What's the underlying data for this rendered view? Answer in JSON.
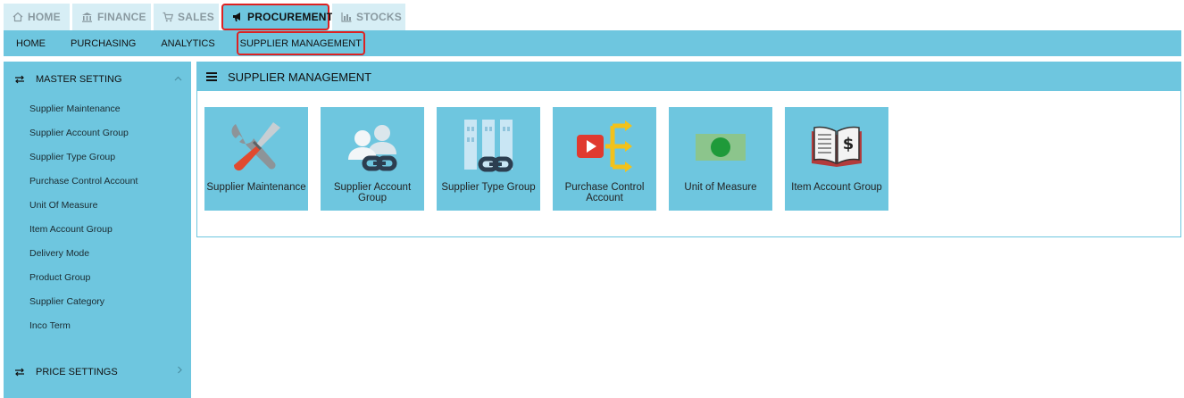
{
  "top_tabs": [
    {
      "label": "HOME",
      "icon": "home-icon"
    },
    {
      "label": "FINANCE",
      "icon": "bank-icon"
    },
    {
      "label": "SALES",
      "icon": "cart-icon"
    },
    {
      "label": "PROCUREMENT",
      "icon": "megaphone-icon",
      "active": true
    },
    {
      "label": "STOCKS",
      "icon": "bar-chart-icon"
    }
  ],
  "subnav": [
    "HOME",
    "PURCHASING",
    "ANALYTICS",
    "SUPPLIER MANAGEMENT"
  ],
  "sidebar": {
    "master_setting": "MASTER SETTING",
    "items": [
      "Supplier Maintenance",
      "Supplier Account Group",
      "Supplier Type Group",
      "Purchase Control Account",
      "Unit Of Measure",
      "Item Account Group",
      "Delivery Mode",
      "Product Group",
      "Supplier Category",
      "Inco Term"
    ],
    "price_settings": "PRICE SETTINGS"
  },
  "panel": {
    "title": "SUPPLIER MANAGEMENT",
    "tiles": [
      {
        "label": "Supplier Maintenance",
        "icon": "tools-icon"
      },
      {
        "label": "Supplier Account Group",
        "icon": "users-link-icon"
      },
      {
        "label": "Supplier Type Group",
        "icon": "buildings-link-icon"
      },
      {
        "label": "Purchase Control Account",
        "icon": "play-split-arrows-icon"
      },
      {
        "label": "Unit of Measure",
        "icon": "money-bill-icon"
      },
      {
        "label": "Item Account Group",
        "icon": "dollar-book-icon"
      }
    ]
  },
  "colors": {
    "accent": "#6ec6df",
    "active_border": "#dd2222",
    "inactive_tab": "#d7eef5"
  }
}
